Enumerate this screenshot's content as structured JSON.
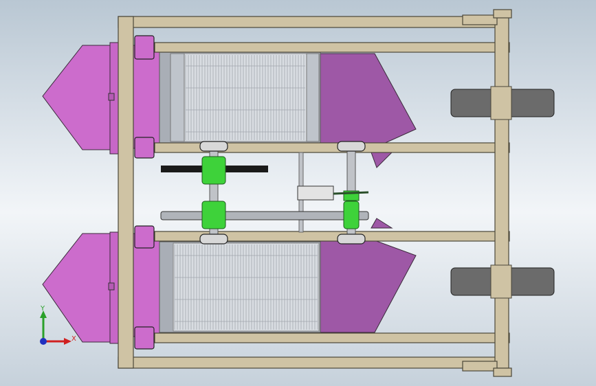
{
  "viewport": {
    "background_top": "#b9c7d3",
    "background_mid": "#f2f5f8"
  },
  "colors": {
    "frame": "#cfc3a4",
    "frame_edge": "#4a4638",
    "hopper_light": "#cc6ccc",
    "hopper_dark": "#9e58a6",
    "sprocket": "#3ed23a",
    "chain": "#1a1a1a",
    "wheel": "#6b6b6b",
    "screen": "#d9dde2",
    "screen_frame": "#a9aeb6"
  },
  "triad": {
    "x_label": "X",
    "y_label": "Y",
    "x_color": "#d02020",
    "y_color": "#2aa02a",
    "z_color": "#2030c0"
  }
}
